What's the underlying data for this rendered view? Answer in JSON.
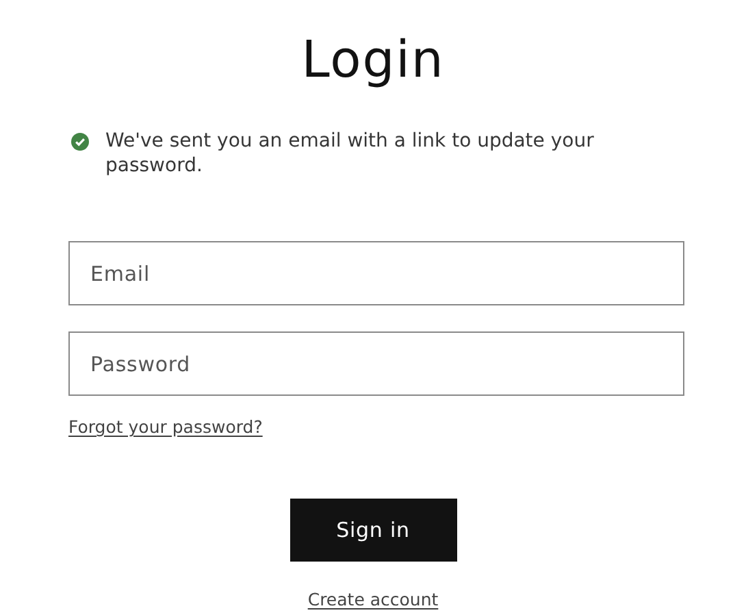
{
  "title": "Login",
  "message": {
    "kind": "success",
    "text": "We've sent you an email with a link to update your password."
  },
  "fields": [
    {
      "placeholder": "Email"
    },
    {
      "placeholder": "Password"
    }
  ],
  "forgot_link": "Forgot your password?",
  "submit_button": "Sign in",
  "create_account_link": "Create account"
}
